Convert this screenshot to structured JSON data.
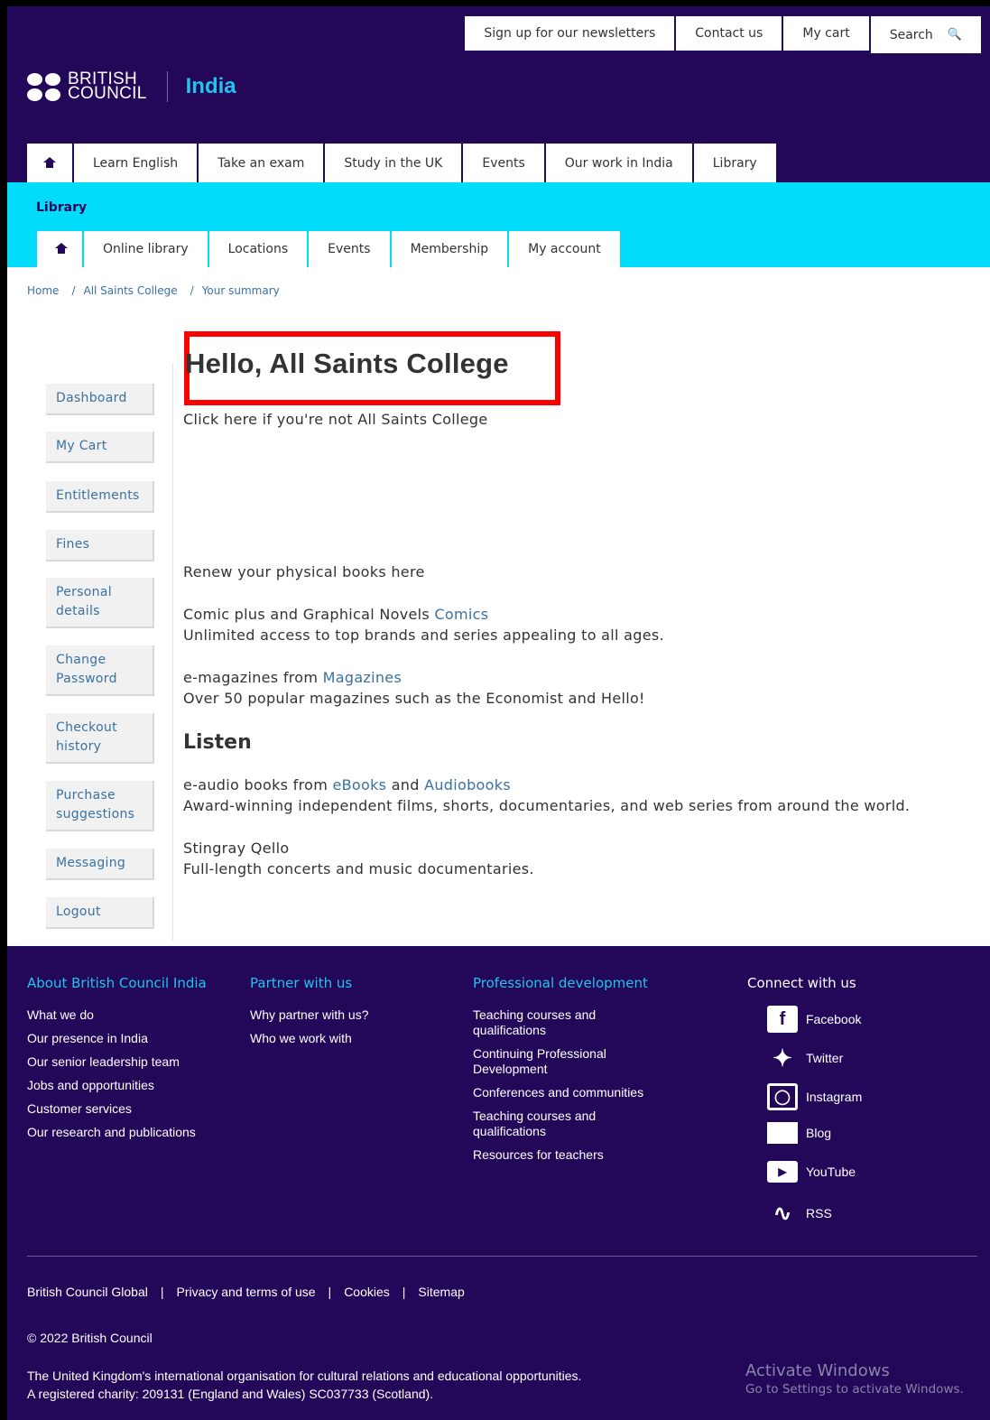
{
  "utility": {
    "newsletter": "Sign up for our newsletters",
    "contact": "Contact us",
    "cart": "My cart",
    "search": "Search"
  },
  "logo": {
    "line1": "BRITISH",
    "line2": "COUNCIL",
    "country": "India"
  },
  "main_nav": [
    "Learn English",
    "Take an exam",
    "Study in the UK",
    "Events",
    "Our work in India",
    "Library"
  ],
  "library": {
    "title": "Library",
    "subnav": [
      "Online library",
      "Locations",
      "Events",
      "Membership",
      "My account"
    ]
  },
  "breadcrumb": [
    "Home",
    "All Saints College",
    "Your summary"
  ],
  "sidebar": [
    "Dashboard",
    "My Cart",
    "Entitlements",
    "Fines",
    "Personal details",
    "Change Password",
    "Checkout history",
    "Purchase suggestions",
    "Messaging",
    "Logout"
  ],
  "content": {
    "greeting": "Hello, All Saints College",
    "not_you": "Click here if you're not All Saints College",
    "renew": "Renew your physical books here",
    "comics_prefix": "Comic plus and Graphical Novels",
    "comics_link": "Comics",
    "comics_desc": "Unlimited access to top brands and series appealing to all ages.",
    "mag_prefix": "e-magazines from",
    "mag_link": "Magazines",
    "mag_desc": "Over 50 popular magazines such as the Economist and Hello!",
    "listen_heading": "Listen",
    "audio_prefix": "e-audio books from",
    "audio_link1": "eBooks",
    "audio_and": "and",
    "audio_link2": "Audiobooks",
    "audio_desc": "Award-winning independent films, shorts, documentaries, and web series from around the world.",
    "stingray_link": "Stingray Qello",
    "stingray_desc": "Full-length concerts and music documentaries."
  },
  "footer": {
    "about": {
      "heading": "About British Council India",
      "links": [
        "What we do",
        "Our presence in India",
        "Our senior leadership team",
        "Jobs and opportunities",
        "Customer services",
        "Our research and publications"
      ]
    },
    "partner": {
      "heading": "Partner with us",
      "links": [
        "Why partner with us?",
        "Who we work with"
      ]
    },
    "prodev": {
      "heading": "Professional development",
      "links": [
        "Teaching courses and qualifications",
        "Continuing Professional Development",
        "Conferences and communities",
        "Teaching courses and qualifications",
        "Resources for teachers"
      ]
    },
    "connect": {
      "heading": "Connect with us",
      "links": [
        "Facebook",
        "Twitter",
        "Instagram",
        "Blog",
        "YouTube",
        "RSS"
      ]
    },
    "legal": [
      "British Council Global",
      "Privacy and terms of use",
      "Cookies",
      "Sitemap"
    ],
    "copyright": "© 2022 British Council",
    "tagline1": "The United Kingdom's international organisation for cultural relations and educational opportunities.",
    "tagline2": "A registered charity: 209131 (England and Wales) SC037733 (Scotland)."
  },
  "activate": {
    "title": "Activate Windows",
    "subtitle": "Go to Settings to activate Windows."
  },
  "colors": {
    "brand_purple": "#23085a",
    "library_cyan": "#00dcfa",
    "link_blue": "#3a71a0",
    "highlight_red": "#ff0000"
  }
}
